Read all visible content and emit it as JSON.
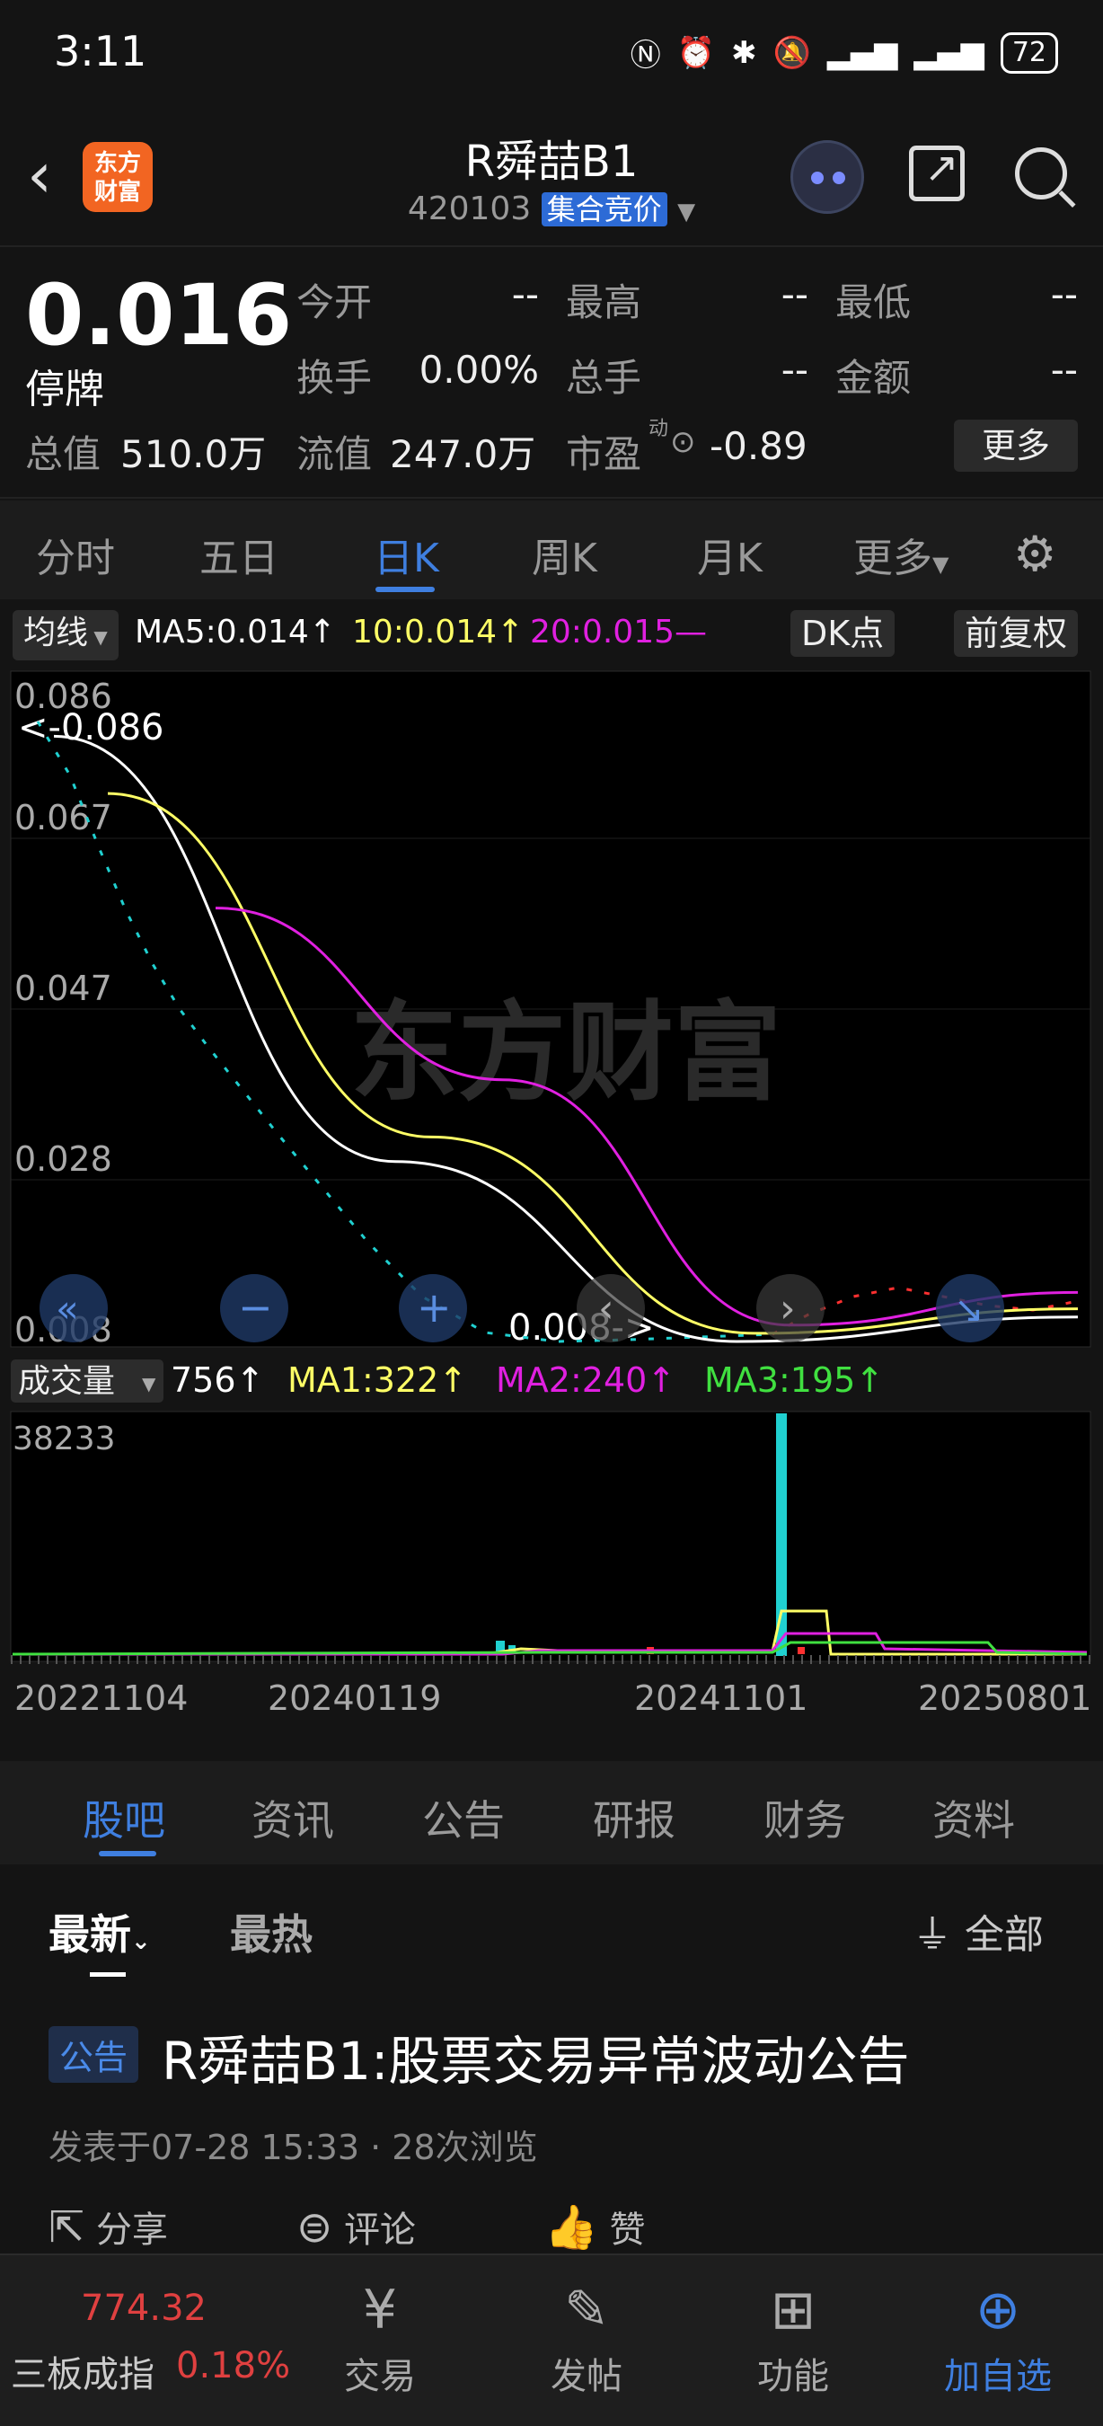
{
  "status_bar": {
    "time": "3:11",
    "battery": "72"
  },
  "header": {
    "stock_name": "R舜喆B1",
    "code": "420103",
    "auction_badge": "集合竞价",
    "logo_text": "东方\n财富"
  },
  "quote": {
    "price": "0.016",
    "status": "停牌",
    "open_label": "今开",
    "open_value": "--",
    "high_label": "最高",
    "high_value": "--",
    "low_label": "最低",
    "low_value": "--",
    "turnover_label": "换手",
    "turnover_value": "0.00%",
    "volume_label": "总手",
    "volume_value": "--",
    "amount_label": "金额",
    "amount_value": "--",
    "mktcap_label": "总值",
    "mktcap_value": "510.0万",
    "float_label": "流值",
    "float_value": "247.0万",
    "pe_label": "市盈",
    "pe_super": "动",
    "pe_value": "-0.89",
    "more_button": "更多"
  },
  "period_tabs": [
    "分时",
    "五日",
    "日K",
    "周K",
    "月K",
    "更多"
  ],
  "active_period": "日K",
  "chart": {
    "ma_selector": "均线",
    "ma5": "MA5:0.014↑",
    "ma10": "10:0.014↑",
    "ma20": "20:0.015—",
    "dk_button": "DK点",
    "adjust_button": "前复权",
    "watermark": "东方财富",
    "price_axis": [
      "0.086",
      "0.067",
      "0.047",
      "0.028",
      "0.008"
    ],
    "high_marker": "<-0.086",
    "low_marker": "0.008->",
    "volume_selector": "成交量",
    "vol_value": "756↑",
    "vol_ma1": "MA1:322↑",
    "vol_ma2": "MA2:240↑",
    "vol_ma3": "MA3:195↑",
    "vol_max": "38233",
    "date_labels": [
      "20221104",
      "20240119",
      "20241101",
      "20250801"
    ],
    "colors": {
      "ma5": "#ffffff",
      "ma10": "#ffff66",
      "ma20": "#e020e0",
      "vol_ma3": "#40e040",
      "candle_up": "#ff3030",
      "candle_down": "#20d0d0"
    }
  },
  "chart_data": {
    "type": "line",
    "title": "",
    "ylim": [
      0.008,
      0.086
    ],
    "x": [
      "20221104",
      "20240119",
      "20241101",
      "20250801"
    ],
    "series": [
      {
        "name": "MA5",
        "values": [
          0.082,
          0.03,
          0.008,
          0.011
        ]
      },
      {
        "name": "10",
        "values": [
          0.075,
          0.033,
          0.009,
          0.012
        ]
      },
      {
        "name": "20",
        "values": [
          0.061,
          0.04,
          0.01,
          0.014
        ]
      }
    ],
    "volume_max": 38233
  },
  "lower_tabs": [
    "股吧",
    "资讯",
    "公告",
    "研报",
    "财务",
    "资料"
  ],
  "active_lower_tab": "股吧",
  "feed": {
    "sort_latest": "最新",
    "sort_hot": "最热",
    "filter_label": "全部",
    "post_tag": "公告",
    "post_title": "R舜喆B1:股票交易异常波动公告",
    "post_meta": "发表于07-28 15:33 · 28次浏览",
    "share_label": "分享",
    "comment_label": "评论",
    "like_label": "赞"
  },
  "bottom_nav": {
    "index_value": "774.32",
    "index_name": "三板成指",
    "index_change": "0.18%",
    "items": [
      "交易",
      "发帖",
      "功能",
      "加自选"
    ]
  }
}
